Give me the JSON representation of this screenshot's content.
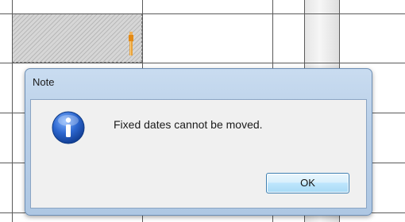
{
  "dialog": {
    "title": "Note",
    "icon": "info-icon",
    "message": "Fixed dates cannot be moved.",
    "ok_label": "OK"
  },
  "scheduler": {
    "fixed_cell_icon": "pin-icon"
  },
  "colors": {
    "dialog_frame": "#b9cfe8",
    "dialog_body": "#f0f0f0",
    "info_icon_blue": "#1f57b8",
    "button_border": "#3c7fb1",
    "pin_orange": "#e38a16"
  }
}
